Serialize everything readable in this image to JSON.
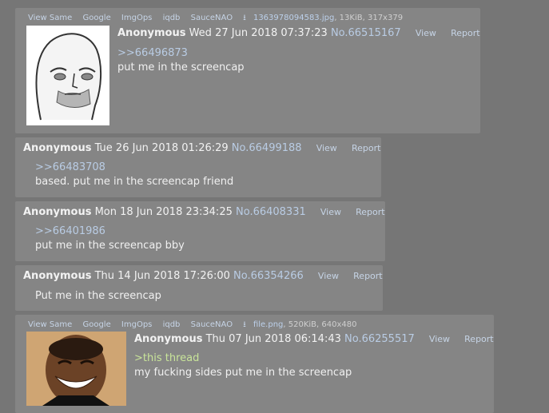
{
  "posts": [
    {
      "tools": [
        "View Same",
        "Google",
        "ImgOps",
        "iqdb",
        "SauceNAO"
      ],
      "file_name": "1363978094583.jpg",
      "file_meta": ", 13KiB, 317x379",
      "name": "Anonymous",
      "date": "Wed 27 Jun 2018 07:37:23",
      "no": "No.66515167",
      "view": "View",
      "report": "Report",
      "quote": ">>66496873",
      "text": "put me in the screencap"
    },
    {
      "name": "Anonymous",
      "date": "Tue 26 Jun 2018 01:26:29",
      "no": "No.66499188",
      "view": "View",
      "report": "Report",
      "quote": ">>66483708",
      "text": "based. put me in the screencap friend"
    },
    {
      "name": "Anonymous",
      "date": "Mon 18 Jun 2018 23:34:25",
      "no": "No.66408331",
      "view": "View",
      "report": "Report",
      "quote": ">>66401986",
      "text": "put me in the screencap bby"
    },
    {
      "name": "Anonymous",
      "date": "Thu 14 Jun 2018 17:26:00",
      "no": "No.66354266",
      "view": "View",
      "report": "Report",
      "text": "Put me in the screencap"
    },
    {
      "tools": [
        "View Same",
        "Google",
        "ImgOps",
        "iqdb",
        "SauceNAO"
      ],
      "file_name": "file.png",
      "file_meta": ", 520KiB, 640x480",
      "name": "Anonymous",
      "date": "Thu 07 Jun 2018 06:14:43",
      "no": "No.66255517",
      "view": "View",
      "report": "Report",
      "greentext": ">this thread",
      "text": "my fucking sides put me in the screencap"
    }
  ],
  "icons": {
    "download": "download-icon"
  }
}
